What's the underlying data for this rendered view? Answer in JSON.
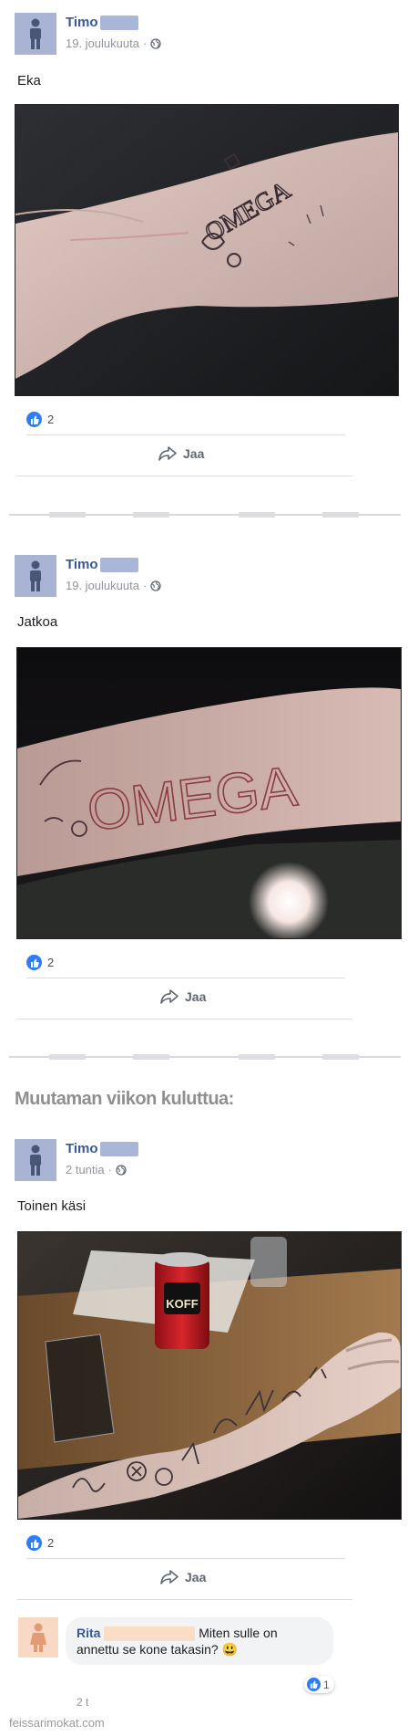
{
  "posts": [
    {
      "author": "Timo",
      "date": "19. joulukuuta",
      "text": "Eka",
      "photo": {
        "tattoo_text": "OMEGA"
      },
      "likes": "2",
      "share_label": "Jaa"
    },
    {
      "author": "Timo",
      "date": "19. joulukuuta",
      "text": "Jatkoa",
      "photo": {
        "tattoo_text": "OMEGA"
      },
      "likes": "2",
      "share_label": "Jaa"
    },
    {
      "author": "Timo",
      "date": "2 tuntia",
      "text": "Toinen käsi",
      "photo": {
        "can_brand": "KOFF"
      },
      "likes": "2",
      "share_label": "Jaa"
    }
  ],
  "section_heading": "Muutaman viikon kuluttua:",
  "comment": {
    "author": "Rita",
    "text": "Miten sulle on annettu se kone takasin? 😃",
    "time": "2 t",
    "reaction_count": "1"
  },
  "watermark": "feissarimokat.com",
  "colors": {
    "link_blue": "#385898",
    "like_blue": "#2f7df6",
    "meta_gray": "#90949c"
  },
  "icons": {
    "globe": "globe-icon",
    "share": "share-arrow-icon",
    "like": "thumbs-up-icon",
    "avatar": "person-silhouette-icon"
  }
}
